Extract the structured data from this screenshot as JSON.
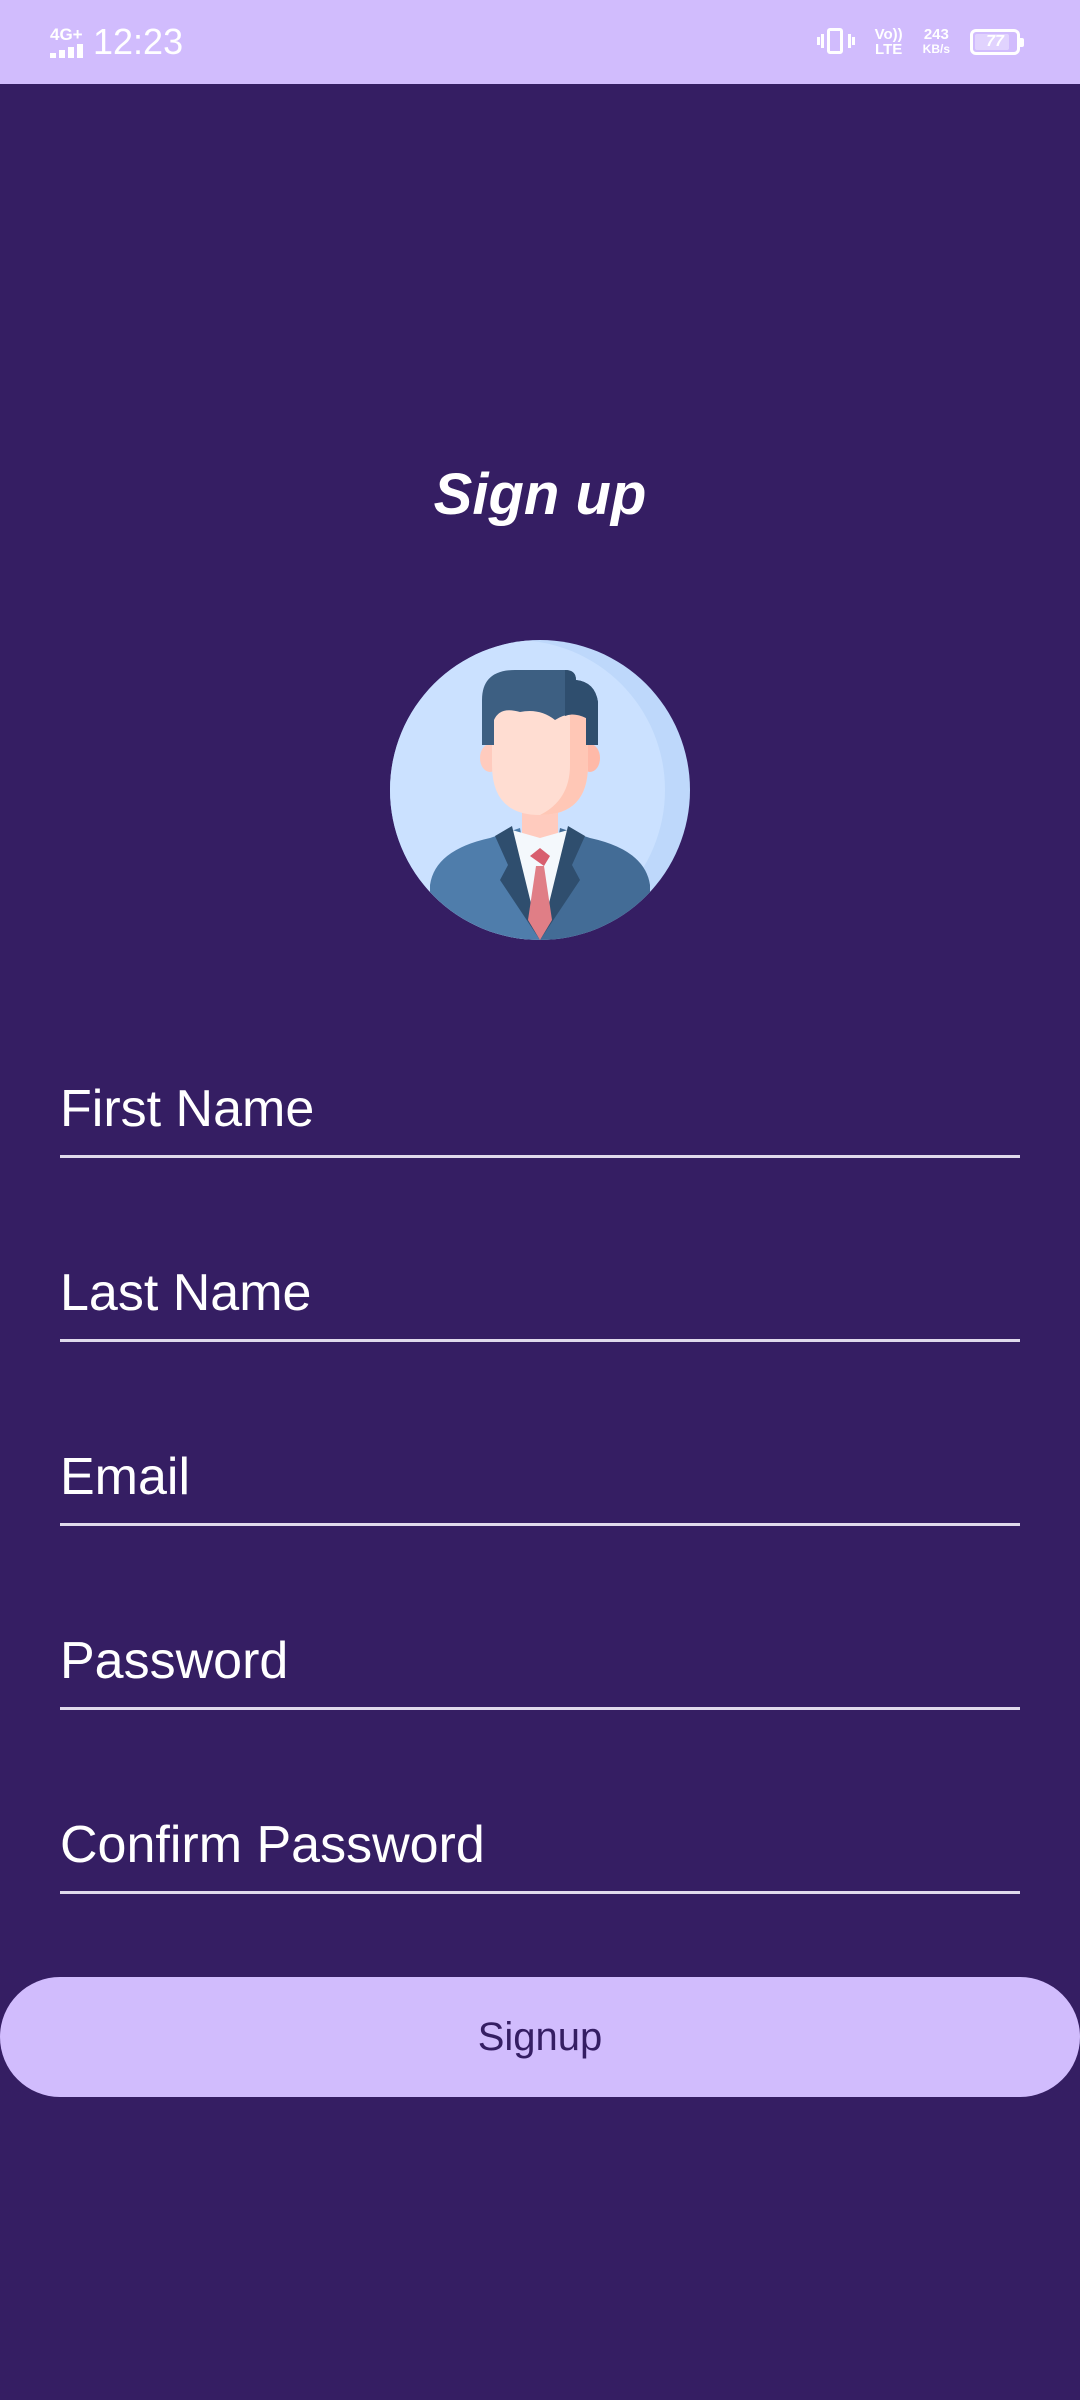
{
  "status_bar": {
    "network_type": "4G+",
    "time": "12:23",
    "volte_top": "Vo))",
    "volte_bottom": "LTE",
    "speed_value": "243",
    "speed_unit": "KB/s",
    "battery_level": "77",
    "icons": [
      "signal-icon",
      "vibrate-icon",
      "volte-icon",
      "battery-icon"
    ]
  },
  "page": {
    "title": "Sign up",
    "avatar_icon": "businessman-avatar-icon"
  },
  "form": {
    "first_name_placeholder": "First Name",
    "last_name_placeholder": "Last Name",
    "email_placeholder": "Email",
    "password_placeholder": "Password",
    "confirm_password_placeholder": "Confirm Password",
    "submit_label": "Signup"
  },
  "colors": {
    "background": "#351E63",
    "accent": "#D1BCFD",
    "text": "#FFFFFF",
    "underline": "#E0DAEC"
  }
}
